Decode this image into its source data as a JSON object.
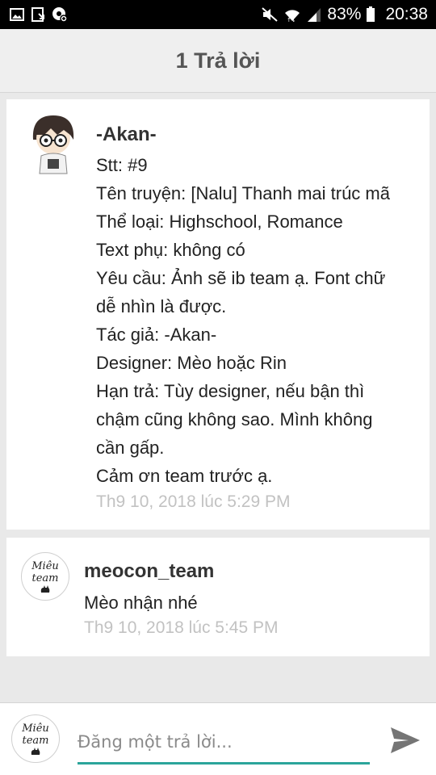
{
  "status_bar": {
    "battery_percent": "83%",
    "time": "20:38",
    "icons": [
      "image-icon",
      "download-icon",
      "settings-notification-icon",
      "mute-icon",
      "wifi-icon",
      "signal-icon",
      "battery-icon"
    ]
  },
  "header": {
    "title": "1 Trả lời"
  },
  "posts": [
    {
      "author": "-Akan-",
      "lines": [
        "Stt: #9",
        "Tên truyện: [Nalu] Thanh mai trúc mã",
        "Thể loại: Highschool, Romance",
        "Text phụ: không có",
        "Yêu cầu: Ảnh sẽ ib team ạ. Font chữ",
        "dễ nhìn là được.",
        "Tác giả: -Akan-",
        "Designer: Mèo hoặc Rin",
        "Hạn trả: Tùy designer, nếu bận thì",
        "chậm cũng không sao. Mình không",
        "cần gấp.",
        "Cảm ơn team trước ạ."
      ],
      "timestamp": "Th9 10, 2018 lúc 5:29 PM"
    },
    {
      "author": "meocon_team",
      "lines": [
        "Mèo nhận nhé"
      ],
      "timestamp": "Th9 10, 2018 lúc 5:45 PM"
    }
  ],
  "team_logo": {
    "line1": "Miêu",
    "line2": "team"
  },
  "composer": {
    "placeholder": "Đăng một trả lời..."
  },
  "colors": {
    "accent": "#2ba59b",
    "timestamp": "#c2c2c2",
    "header_bg": "#efefef"
  }
}
